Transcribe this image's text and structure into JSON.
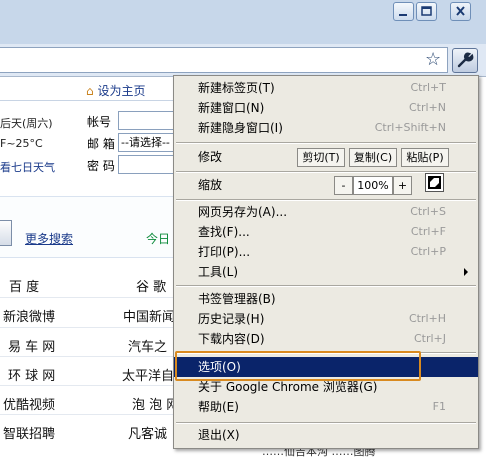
{
  "page": {
    "home_link": "设为主页",
    "weather": [
      "后天(周六)",
      "F~25°C",
      "看七日天气"
    ],
    "login": {
      "account_label": "帐号",
      "mailbox_label": "邮 箱",
      "mailbox_select": "--请选择--",
      "password_label": "密 码"
    },
    "more_search": "更多搜索",
    "today_label": "今日",
    "sites_left": [
      "百  度",
      "新浪微博",
      "易 车 网",
      "环 球 网",
      "优酷视频",
      "智联招聘"
    ],
    "sites_right": [
      "谷  歌",
      "中国新闻",
      "汽车之",
      "太平洋自",
      "泡 泡 网",
      "凡客诚"
    ],
    "bottom_fragment": "……仙吉本沟 ……图腾"
  },
  "menu": {
    "items": [
      {
        "label": "新建标签页(T)",
        "shortcut": "Ctrl+T"
      },
      {
        "label": "新建窗口(N)",
        "shortcut": "Ctrl+N"
      },
      {
        "label": "新建隐身窗口(I)",
        "shortcut": "Ctrl+Shift+N"
      }
    ],
    "edit": {
      "label": "修改",
      "cut": "剪切(T)",
      "copy": "复制(C)",
      "paste": "粘贴(P)"
    },
    "zoom": {
      "label": "缩放",
      "minus": "-",
      "value": "100%",
      "plus": "+"
    },
    "items2": [
      {
        "label": "网页另存为(A)...",
        "shortcut": "Ctrl+S"
      },
      {
        "label": "查找(F)...",
        "shortcut": "Ctrl+F"
      },
      {
        "label": "打印(P)...",
        "shortcut": "Ctrl+P"
      },
      {
        "label": "工具(L)",
        "shortcut": ""
      }
    ],
    "items3": [
      {
        "label": "书签管理器(B)",
        "shortcut": ""
      },
      {
        "label": "历史记录(H)",
        "shortcut": "Ctrl+H"
      },
      {
        "label": "下载内容(D)",
        "shortcut": "Ctrl+J"
      }
    ],
    "items4": [
      {
        "label": "选项(O)",
        "shortcut": ""
      },
      {
        "label": "关于 Google Chrome 浏览器(G)",
        "shortcut": ""
      },
      {
        "label": "帮助(E)",
        "shortcut": "F1"
      }
    ],
    "exit": {
      "label": "退出(X)",
      "shortcut": ""
    }
  },
  "colors": {
    "selection": "#0a246a",
    "highlight_box": "#d98a1f",
    "menu_bg": "#eceae2"
  }
}
